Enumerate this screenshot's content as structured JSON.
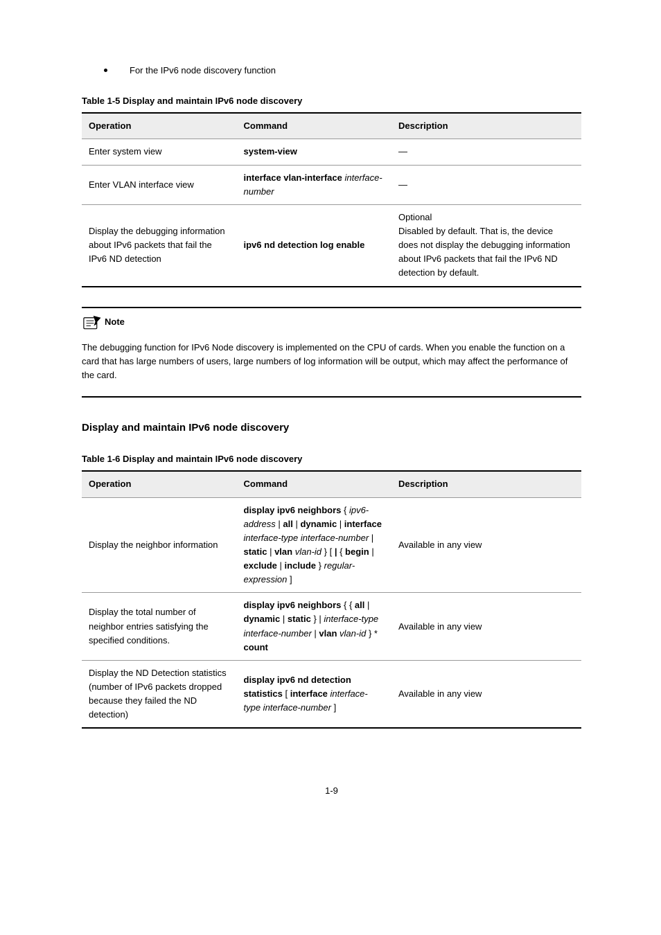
{
  "bullet": "For the IPv6 node discovery function",
  "tables": {
    "headers": {
      "op": "Operation",
      "cmd": "Command",
      "desc": "Description"
    },
    "t1": {
      "caption": "Table 1-5 Display and maintain IPv6 node discovery",
      "rows": [
        {
          "op": "Enter system view",
          "cmd": "system-view",
          "desc": "—"
        },
        {
          "op": "Enter VLAN interface view",
          "cmd": "interface vlan-interface interface-number",
          "desc": "—"
        },
        {
          "op": "Display the debugging information about IPv6 packets that fail the IPv6 ND detection",
          "cmd": "ipv6 nd detection log enable",
          "desc": "Optional\nDisabled by default. That is, the device does not display the debugging information about IPv6 packets that fail the IPv6 ND detection by default."
        }
      ]
    },
    "t2": {
      "caption": "Table 1-6 Display and maintain IPv6 node discovery",
      "rows": [
        {
          "op": "Display the neighbor information",
          "cmd": "display ipv6 neighbors { ipv6-address | all | dynamic | interface interface-type interface-number | static | vlan vlan-id } [ | { begin | exclude | include } regular-expression ]",
          "desc": "Available in any view"
        },
        {
          "op": "Display the total number of neighbor entries satisfying the specified conditions.",
          "cmd": "display ipv6 neighbors { { all | dynamic | static } | interface-type interface-number | vlan vlan-id } * count",
          "desc": "Available in any view"
        },
        {
          "op": "Display the ND Detection statistics (number of IPv6 packets dropped because they failed the ND detection)",
          "cmd": "display ipv6 nd detection statistics [ interface interface-type interface-number ]",
          "desc": "Available in any view"
        }
      ]
    }
  },
  "note": {
    "label": "Note",
    "lines": [
      "The debugging function for IPv6 Node discovery is implemented on the CPU of cards. When you enable the function on a card that has large numbers of users, large numbers of log information will be output, which may affect the performance of the card."
    ]
  },
  "section": "Display and maintain IPv6 node discovery",
  "page_number": "1-9"
}
